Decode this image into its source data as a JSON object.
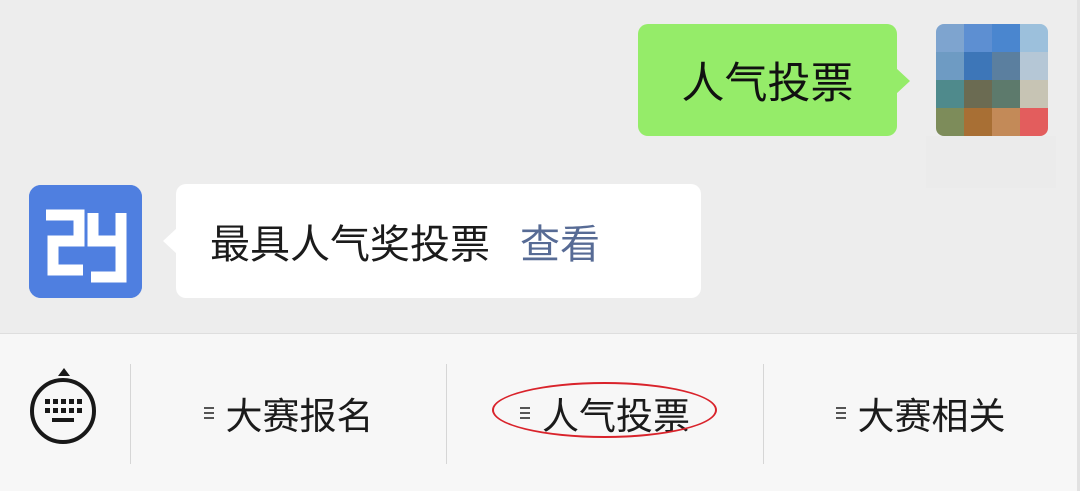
{
  "chat": {
    "messages": [
      {
        "direction": "outgoing",
        "text": "人气投票"
      },
      {
        "direction": "incoming",
        "text": "最具人气奖投票",
        "link_text": "查看"
      }
    ]
  },
  "menu": {
    "items": [
      {
        "label": "大赛报名"
      },
      {
        "label": "人气投票",
        "highlighted": true
      },
      {
        "label": "大赛相关"
      }
    ]
  },
  "colors": {
    "background": "#ededed",
    "outgoing_bubble": "#95ec69",
    "incoming_bubble": "#ffffff",
    "link": "#576b95",
    "bot_avatar": "#4f7fe0",
    "highlight_circle": "#d9232b"
  },
  "icons": {
    "user_avatar": "pixelated-user-avatar",
    "bot_avatar": "brand-logo-avatar",
    "keyboard": "keyboard-icon",
    "menu_item": "hamburger-icon"
  }
}
